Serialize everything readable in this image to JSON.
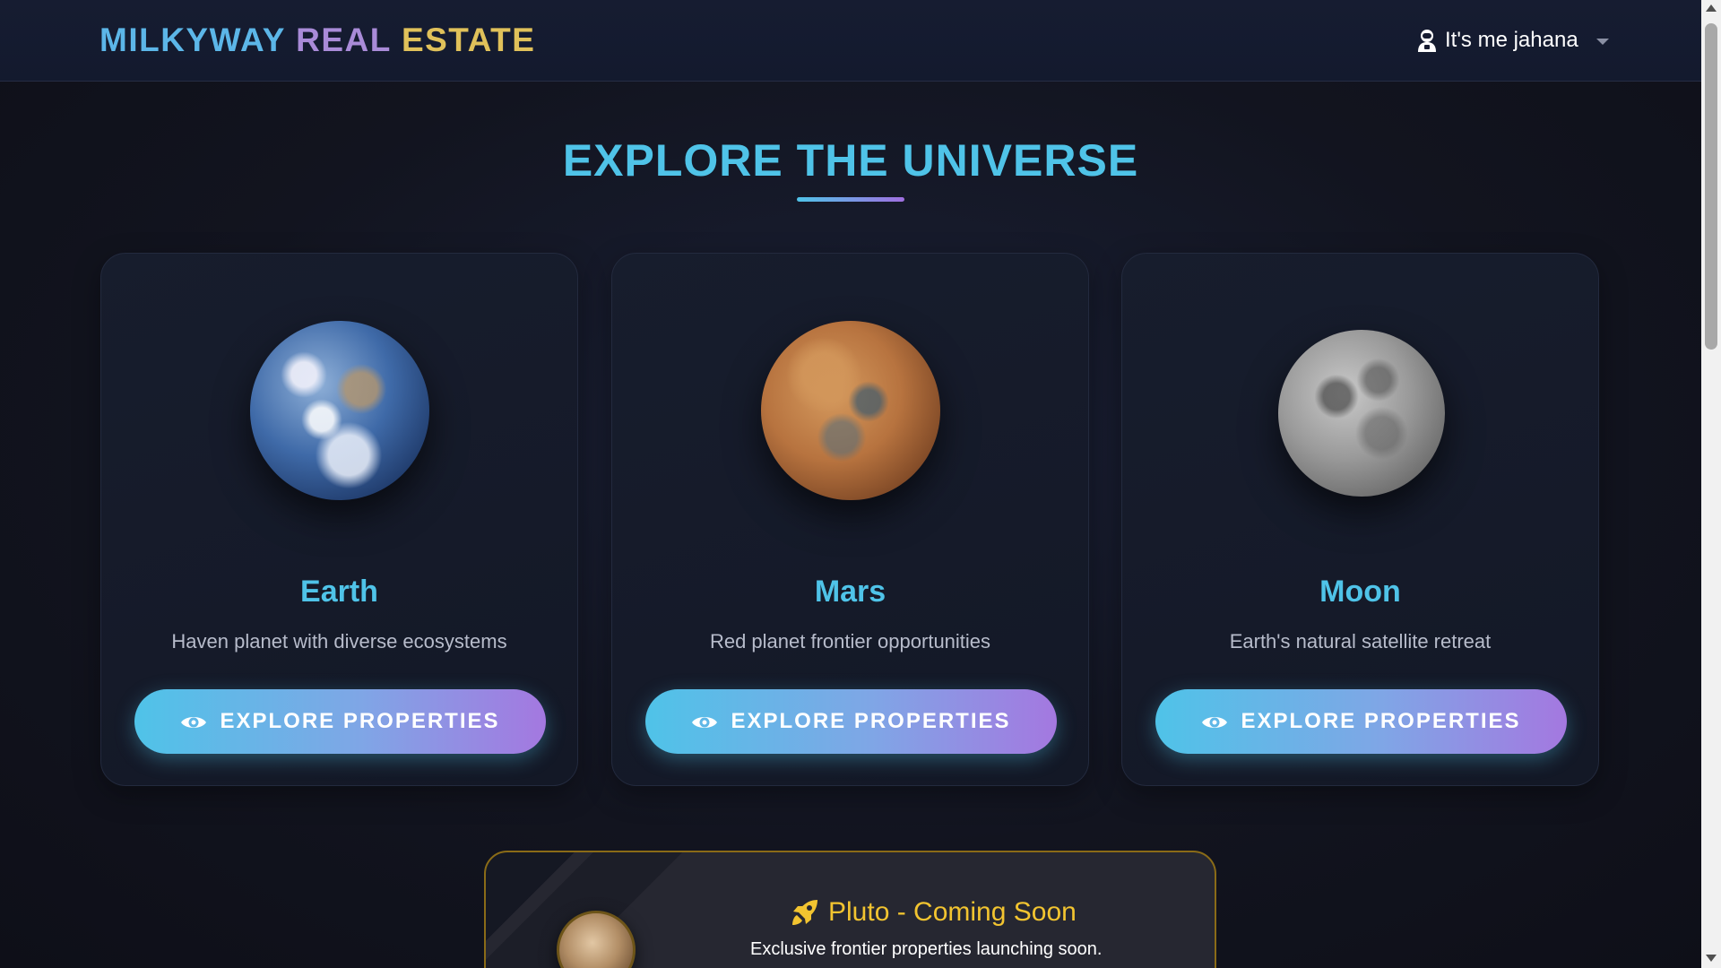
{
  "navbar": {
    "brand": {
      "word1": "MILKYWAY",
      "word2": "REAL",
      "word3": "ESTATE"
    },
    "user": {
      "label": "It's me jahana",
      "icon": "user-astronaut-icon"
    }
  },
  "hero": {
    "title": "EXPLORE THE UNIVERSE"
  },
  "cards": [
    {
      "name": "Earth",
      "description": "Haven planet with diverse ecosystems",
      "button_label": "EXPLORE PROPERTIES",
      "button_icon": "eye-icon"
    },
    {
      "name": "Mars",
      "description": "Red planet frontier opportunities",
      "button_label": "EXPLORE PROPERTIES",
      "button_icon": "eye-icon"
    },
    {
      "name": "Moon",
      "description": "Earth's natural satellite retreat",
      "button_label": "EXPLORE PROPERTIES",
      "button_icon": "eye-icon"
    }
  ],
  "coming_soon": {
    "title": "Pluto - Coming Soon",
    "icon": "rocket-icon",
    "description": "Exclusive frontier properties launching soon."
  },
  "colors": {
    "accent_cyan": "#4fc3e8",
    "accent_purple": "#a478e0",
    "gold": "#f2c430",
    "background": "#12141f"
  }
}
